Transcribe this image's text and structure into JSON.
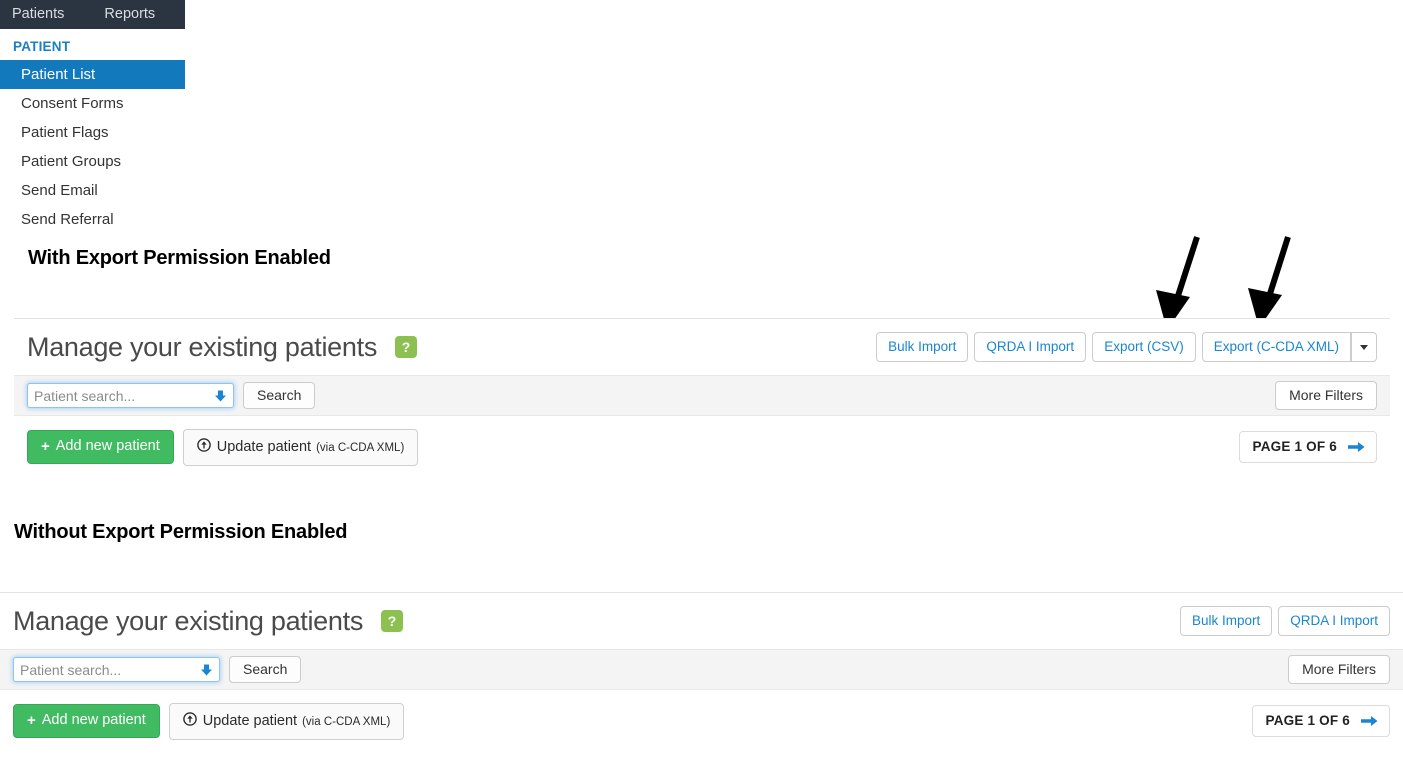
{
  "topnav": {
    "items": [
      {
        "label": "Patients"
      },
      {
        "label": "Reports"
      }
    ]
  },
  "sidebar": {
    "heading": "PATIENT",
    "items": [
      {
        "label": "Patient List"
      },
      {
        "label": "Consent Forms"
      },
      {
        "label": "Patient Flags"
      },
      {
        "label": "Patient Groups"
      },
      {
        "label": "Send Email"
      },
      {
        "label": "Send Referral"
      }
    ]
  },
  "sections": {
    "with_export": {
      "title": "With Export Permission Enabled",
      "panel": {
        "title": "Manage your existing patients",
        "help_badge": "?",
        "header_buttons": [
          {
            "label": "Bulk Import"
          },
          {
            "label": "QRDA I Import"
          },
          {
            "label": "Export (CSV)"
          },
          {
            "label": "Export (C-CDA XML)"
          }
        ],
        "has_export_dropdown": true,
        "search": {
          "placeholder": "Patient search...",
          "value": "",
          "search_button": "Search",
          "more_filters_button": "More Filters"
        },
        "actions": {
          "add_label": "Add new patient",
          "add_plus": "+",
          "update_label": "Update patient",
          "update_sub": "(via C-CDA XML)"
        },
        "pager": {
          "label": "PAGE 1 OF 6"
        }
      }
    },
    "without_export": {
      "title": "Without Export Permission Enabled",
      "panel": {
        "title": "Manage your existing patients",
        "help_badge": "?",
        "header_buttons": [
          {
            "label": "Bulk Import"
          },
          {
            "label": "QRDA I Import"
          }
        ],
        "has_export_dropdown": false,
        "search": {
          "placeholder": "Patient search...",
          "value": "",
          "search_button": "Search",
          "more_filters_button": "More Filters"
        },
        "actions": {
          "add_label": "Add new patient",
          "add_plus": "+",
          "update_label": "Update patient",
          "update_sub": "(via C-CDA XML)"
        },
        "pager": {
          "label": "PAGE 1 OF 6"
        }
      }
    }
  },
  "annotations": {
    "arrow_1": "arrow pointing to Export (CSV) button",
    "arrow_2": "arrow pointing to Export (C-CDA XML) button"
  },
  "colors": {
    "navbar": "#2b3542",
    "sidebar_active": "#1379bd",
    "sidebar_heading": "#1b7fc4",
    "link_blue": "#1a86d0",
    "help_green": "#8cc152",
    "add_green": "#41bb61"
  }
}
